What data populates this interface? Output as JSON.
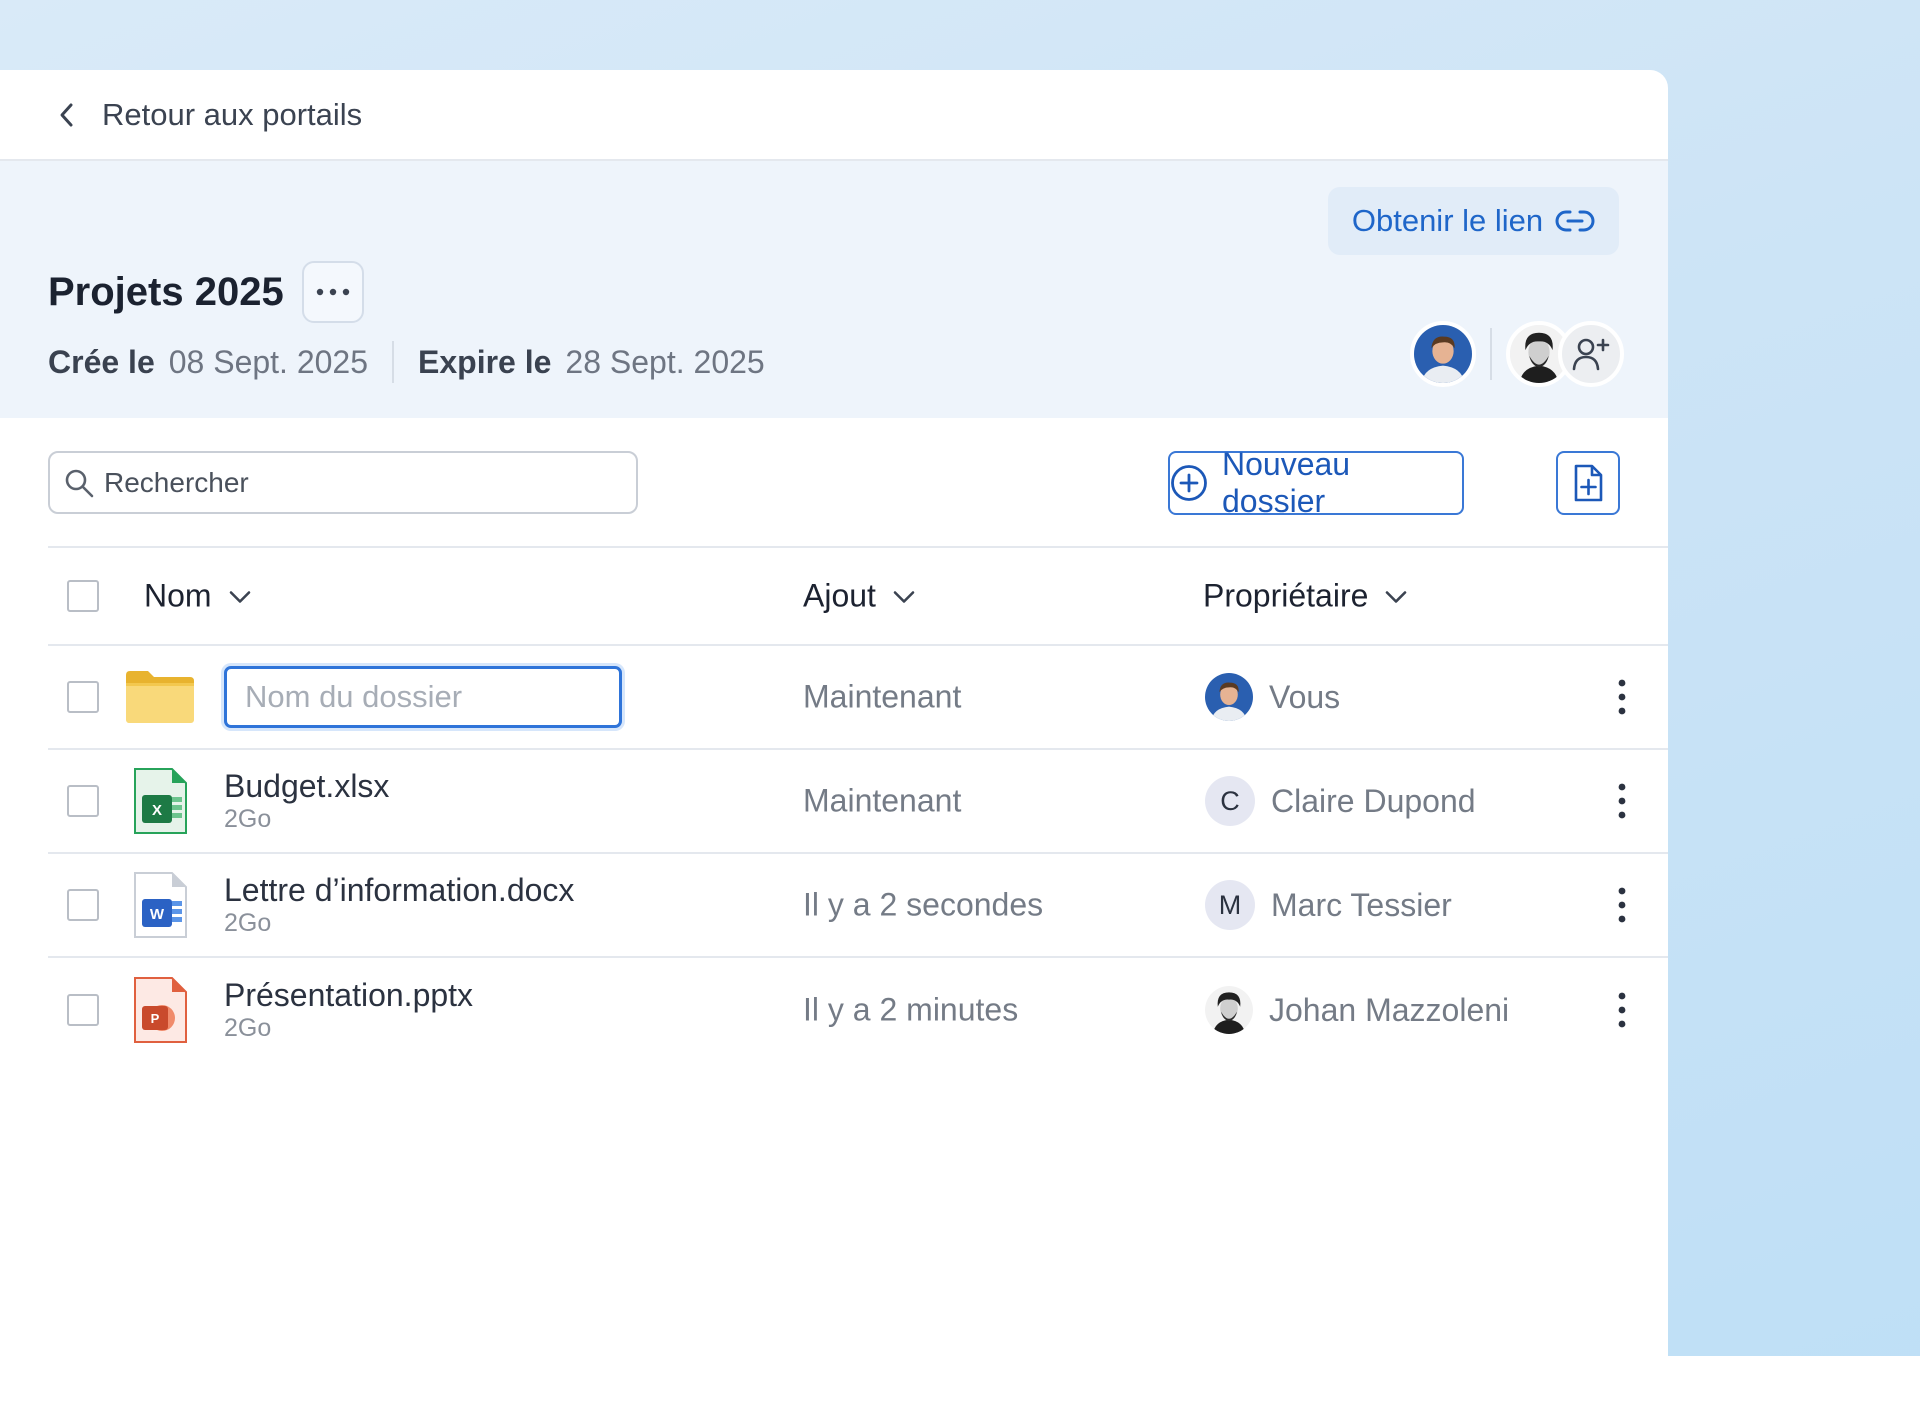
{
  "nav": {
    "back_label": "Retour aux portails"
  },
  "portal": {
    "title": "Projets 2025",
    "get_link_label": "Obtenir le lien",
    "created_label": "Crée le",
    "created_value": "08 Sept. 2025",
    "expires_label": "Expire le",
    "expires_value": "28 Sept. 2025"
  },
  "toolbar": {
    "search_placeholder": "Rechercher",
    "new_folder_label": "Nouveau dossier"
  },
  "table": {
    "columns": {
      "name": "Nom",
      "added": "Ajout",
      "owner": "Propriétaire"
    },
    "new_folder_row": {
      "placeholder": "Nom du dossier",
      "added": "Maintenant",
      "owner": "Vous"
    },
    "files": [
      {
        "name": "Budget.xlsx",
        "size": "2Go",
        "added": "Maintenant",
        "owner": "Claire Dupond",
        "owner_initial": "C",
        "type": "excel"
      },
      {
        "name": "Lettre d’information.docx",
        "size": "2Go",
        "added": "Il y a 2 secondes",
        "owner": "Marc Tessier",
        "owner_initial": "M",
        "type": "word"
      },
      {
        "name": "Présentation.pptx",
        "size": "2Go",
        "added": "Il y a 2 minutes",
        "owner": "Johan Mazzoleni",
        "owner_initial": "",
        "type": "powerpoint"
      }
    ]
  },
  "icons": {
    "back": "chevron-left-icon",
    "link": "link-icon",
    "more": "more-horizontal-icon",
    "add_member": "user-plus-icon",
    "search": "search-icon",
    "new_folder": "plus-circle-icon",
    "upload": "file-plus-icon",
    "sort": "chevron-down-icon",
    "row_menu": "more-vertical-icon"
  },
  "colors": {
    "accent": "#1f66c9",
    "header_band": "#eef4fb",
    "excel": "#1d7a45",
    "word": "#2b62c4",
    "powerpoint": "#c94a2c",
    "folder": "#f6cf5c"
  }
}
